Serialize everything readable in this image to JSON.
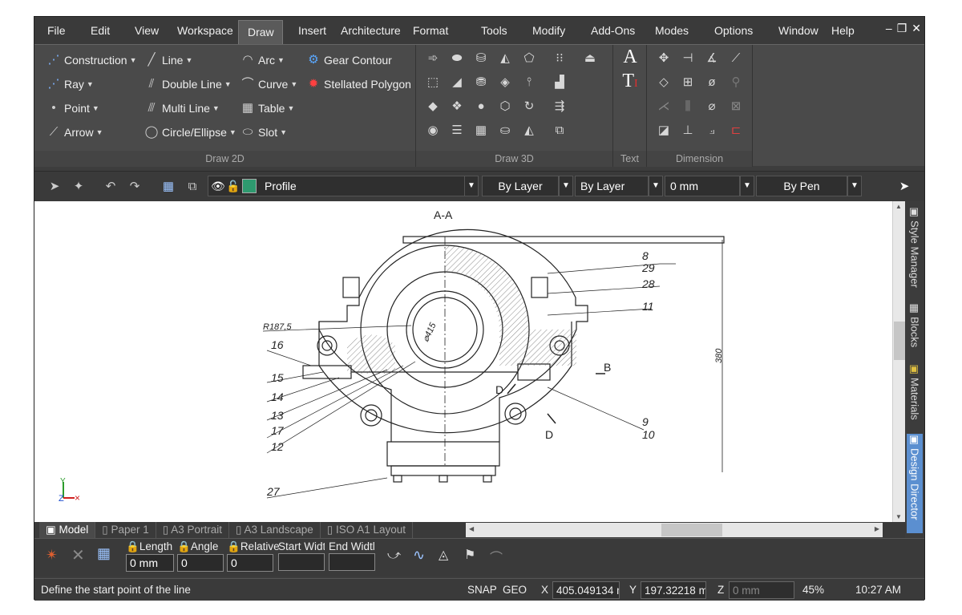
{
  "menu": [
    "File",
    "Edit",
    "View",
    "Workspace",
    "Draw",
    "Insert",
    "Architecture",
    "Format",
    "Tools",
    "Modify",
    "Add-Ons",
    "Modes",
    "Options",
    "Window",
    "Help"
  ],
  "ribbon": {
    "draw2d": {
      "construction": "Construction",
      "ray": "Ray",
      "point": "Point",
      "arrow": "Arrow",
      "line": "Line",
      "double_line": "Double Line",
      "multi_line": "Multi Line",
      "circle": "Circle/Ellipse",
      "arc": "Arc",
      "curve": "Curve",
      "table": "Table",
      "slot": "Slot",
      "gear": "Gear Contour",
      "stellated": "Stellated Polygon",
      "label": "Draw 2D"
    },
    "draw3d_label": "Draw 3D",
    "text_label": "Text",
    "dimension_label": "Dimension"
  },
  "props": {
    "layer": "Profile",
    "color": "By Layer",
    "linetype": "By Layer",
    "width": "0 mm",
    "pen": "By Pen"
  },
  "drawing": {
    "section": "A-A",
    "radius": "R187,5",
    "diameter": "⌀415",
    "height": "380",
    "callouts": [
      "8",
      "29",
      "28",
      "11",
      "16",
      "15",
      "14",
      "13",
      "17",
      "12",
      "27",
      "9",
      "10"
    ],
    "marks": [
      "B",
      "D",
      "D"
    ]
  },
  "side_tabs": [
    "Style Manager",
    "Blocks",
    "Materials",
    "Design Director"
  ],
  "layout_tabs": [
    "Model",
    "Paper 1",
    "A3 Portrait",
    "A3 Landscape",
    "ISO A1 Layout"
  ],
  "inputs": {
    "length": {
      "label": "Length",
      "value": "0 mm"
    },
    "angle": {
      "label": "Angle",
      "value": "0"
    },
    "relative": {
      "label": "Relative",
      "value": "0"
    },
    "start_width": {
      "label": "Start Widt",
      "value": ""
    },
    "end_width": {
      "label": "End Widtl",
      "value": ""
    }
  },
  "status": {
    "prompt": "Define the start point of the line",
    "snap": "SNAP",
    "geo": "GEO",
    "x": "405.049134 n",
    "y": "197.32218 m",
    "z": "0 mm",
    "zoom": "45%",
    "time": "10:27 AM"
  }
}
